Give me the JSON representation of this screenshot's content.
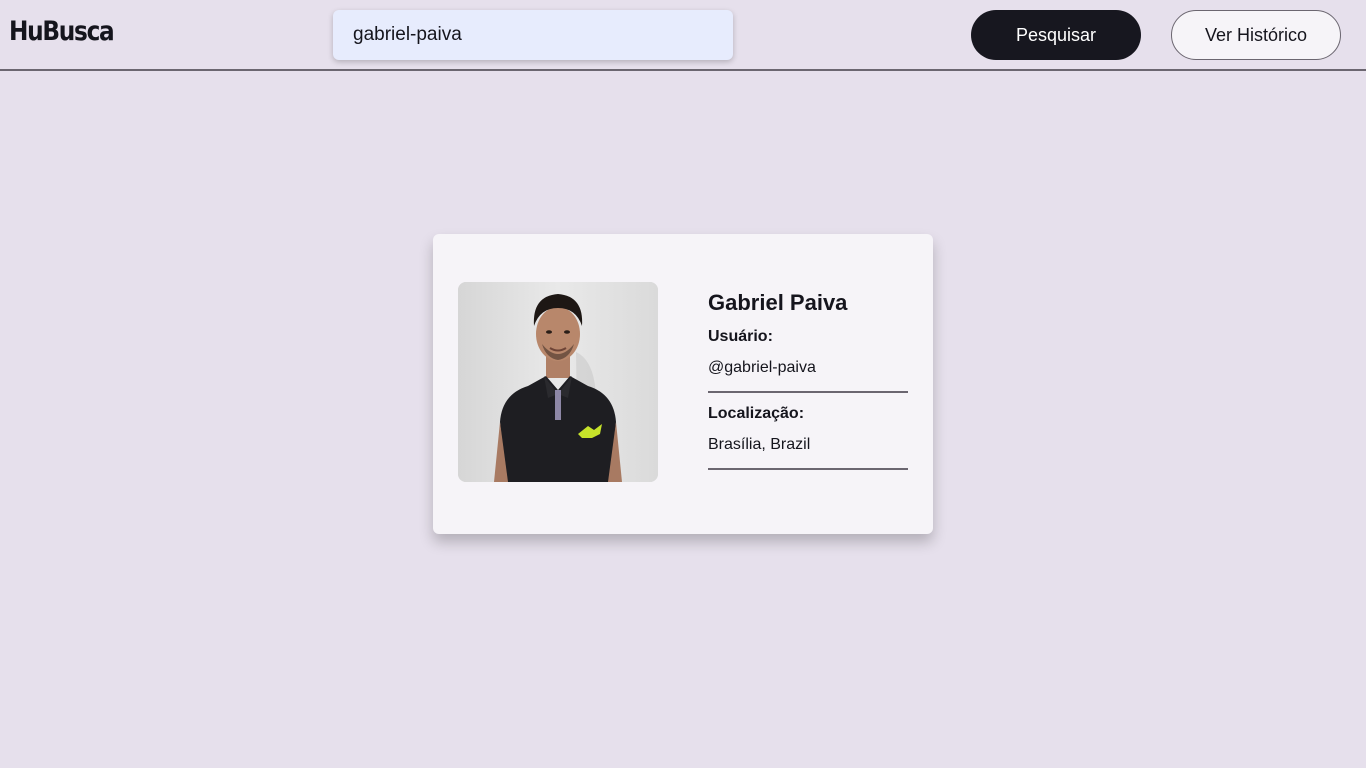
{
  "header": {
    "logo": "HuBusca",
    "search_value": "gabriel-paiva",
    "search_button_label": "Pesquisar",
    "history_button_label": "Ver Histórico"
  },
  "profile": {
    "name": "Gabriel Paiva",
    "user_label": "Usuário:",
    "username": "@gabriel-paiva",
    "location_label": "Localização:",
    "location": "Brasília, Brazil"
  },
  "colors": {
    "background": "#e6e0ec",
    "card": "#f6f4f8",
    "search_field": "#e7ecfd",
    "primary_button": "#17171f",
    "divider": "#6b6670"
  }
}
